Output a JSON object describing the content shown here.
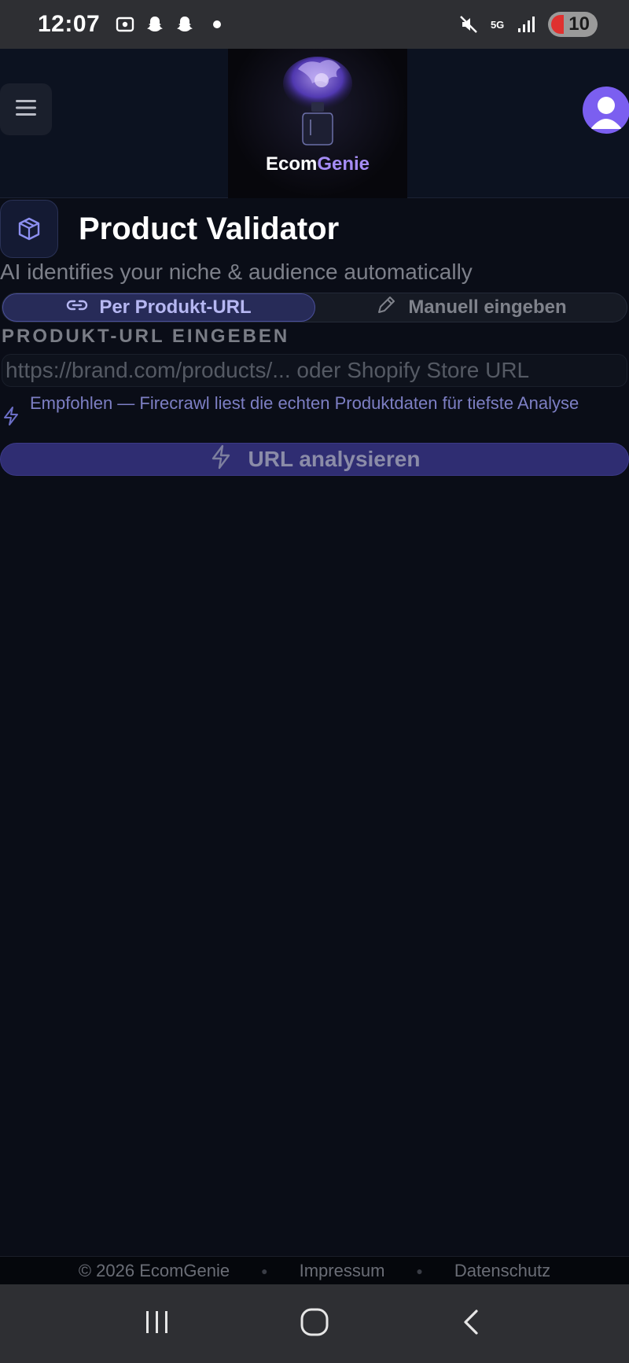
{
  "status_bar": {
    "time": "12:07",
    "network": "5G",
    "battery": "10",
    "icons_left": [
      "screenshot-icon",
      "snapchat-icon",
      "snapchat-icon"
    ],
    "icons_right": [
      "mute-icon",
      "5g-icon",
      "signal-icon",
      "battery-icon"
    ]
  },
  "header": {
    "logo_text_main": "Ecom",
    "logo_text_accent": "Genie",
    "menu_icon": "menu-icon",
    "avatar_icon": "user-icon"
  },
  "page": {
    "icon": "cube-icon",
    "title": "Product Validator",
    "subtitle": "AI identifies your niche & audience automatically"
  },
  "tabs": [
    {
      "label": "Per Produkt-URL",
      "icon": "link-icon",
      "active": true
    },
    {
      "label": "Manuell eingeben",
      "icon": "pencil-icon",
      "active": false
    }
  ],
  "form": {
    "section_label": "PRODUKT-URL EINGEBEN",
    "url_value": "",
    "url_placeholder": "https://brand.com/products/... oder Shopify Store URL",
    "hint": "Empfohlen — Firecrawl liest die echten Produktdaten für tiefste Analyse",
    "submit_label": "URL analysieren"
  },
  "footer": {
    "copyright": "© 2026 EcomGenie",
    "impressum": "Impressum",
    "datenschutz": "Datenschutz"
  },
  "colors": {
    "background": "#0a0d17",
    "accent": "#7b5ff0",
    "tab_active": "#272b58",
    "button": "#2f2d72"
  }
}
